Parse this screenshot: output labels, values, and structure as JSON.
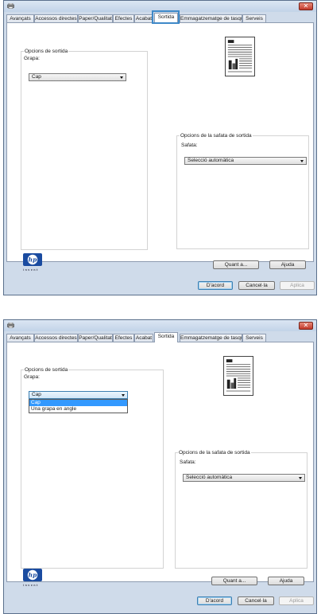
{
  "tabs": [
    "Avançats",
    "Accessos directes",
    "Paper/Qualitat",
    "Efectes",
    "Acabat",
    "Sortida",
    "Emmagatzematge de tasques",
    "Serveis"
  ],
  "window_close_glyph": "✕",
  "logo_text": "hp",
  "logo_tagline": "invent",
  "screen1": {
    "active_tab": "Sortida",
    "output_options_legend": "Opcions de sortida",
    "staple_label": "Grapa:",
    "staple_value": "Cap",
    "tray_legend": "Opcions de la safata de sortida",
    "tray_label": "Safata:",
    "tray_value": "Selecció automàtica",
    "about_button": "Quant a...",
    "help_button": "Ajuda",
    "ok_button": "D'acord",
    "cancel_button": "Cancel·la",
    "apply_button": "Aplica"
  },
  "screen2": {
    "active_tab": "Sortida",
    "output_options_legend": "Opcions de sortida",
    "staple_label": "Grapa:",
    "staple_value": "Cap",
    "staple_options": [
      "Cap",
      "Una grapa en angle"
    ],
    "staple_selected_option": "Cap",
    "tray_legend": "Opcions de la safata de sortida",
    "tray_label": "Safata:",
    "tray_value": "Selecció automàtica",
    "about_button": "Quant a...",
    "help_button": "Ajuda",
    "ok_button": "D'acord",
    "cancel_button": "Cancel·la",
    "apply_button": "Aplica"
  },
  "icons": {
    "window_icon": "printer-icon",
    "close": "close-icon",
    "dropdown_arrow": "chevron-down-icon",
    "logo": "hp-logo-icon",
    "preview": "document-preview-icon"
  },
  "colors": {
    "window_frame": "#cfdbea",
    "tab_highlight": "#3e89c8",
    "close_button": "#c2392a",
    "selection": "#3399ff"
  }
}
